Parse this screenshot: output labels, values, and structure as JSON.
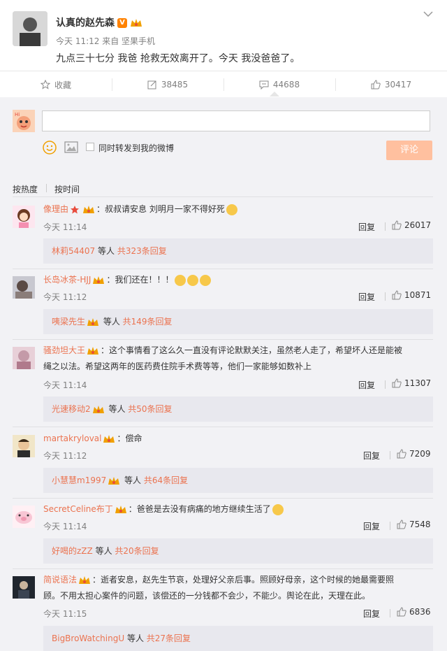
{
  "post": {
    "author": "认真的赵先森",
    "time": "今天 11:12 来自 坚果手机",
    "text": "九点三十七分 我爸 抢救无效离开了。今天 我没爸爸了。"
  },
  "actions": {
    "favorite": "收藏",
    "forward": "38485",
    "comments": "44688",
    "likes": "30417"
  },
  "compose": {
    "forward_label": "同时转发到我的微博",
    "submit": "评论"
  },
  "sort": {
    "hot": "按热度",
    "time": "按时间"
  },
  "comments": [
    {
      "user": "像理由",
      "text": "：叔叔请安息 刘明月一家不得好死",
      "time": "今天 11:14",
      "reply": "回复",
      "likes": "26017",
      "sub_user": "林莉54407",
      "sub_mid": " 等人 ",
      "sub_count": "共323条回复"
    },
    {
      "user": "长岛冰茶-HJJ",
      "text": "：我们还在！！！",
      "time": "今天 11:12",
      "reply": "回复",
      "likes": "10871",
      "sub_user": "咦梁先生",
      "sub_mid": " 等人 ",
      "sub_count": "共149条回复"
    },
    {
      "user": "骚劲坦大王",
      "text": "：这个事情看了这么久一直没有评论默默关注，虽然老人走了，希望坏人还是能被",
      "text2": "绳之以法。希望这两年的医药费住院手术费等等，他们一家能够如数补上",
      "time": "今天 11:14",
      "reply": "回复",
      "likes": "11307",
      "sub_user": "光速移动2",
      "sub_mid": " 等人 ",
      "sub_count": "共50条回复"
    },
    {
      "user": "martakryloval",
      "text": "：偿命",
      "time": "今天 11:12",
      "reply": "回复",
      "likes": "7209",
      "sub_user": "小慧慧m1997",
      "sub_mid": " 等人 ",
      "sub_count": "共64条回复"
    },
    {
      "user": "SecretCeline布丁",
      "text": "：爸爸是去没有病痛的地方继续生活了",
      "time": "今天 11:14",
      "reply": "回复",
      "likes": "7548",
      "sub_user": "好喝的zZZ",
      "sub_mid": " 等人 ",
      "sub_count": "共20条回复"
    },
    {
      "user": "简说语法",
      "text": "：逝者安息，赵先生节哀，处理好父亲后事。照顾好母亲，这个时候的她最需要照",
      "text2": "顾。不用太担心案件的问题，该偿还的一分钱都不会少，不能少。舆论在此，天理在此。",
      "time": "今天 11:15",
      "reply": "回复",
      "likes": "6836",
      "sub_user": "BigBroWatchingU",
      "sub_mid": " 等人 ",
      "sub_count": "共27条回复"
    }
  ]
}
